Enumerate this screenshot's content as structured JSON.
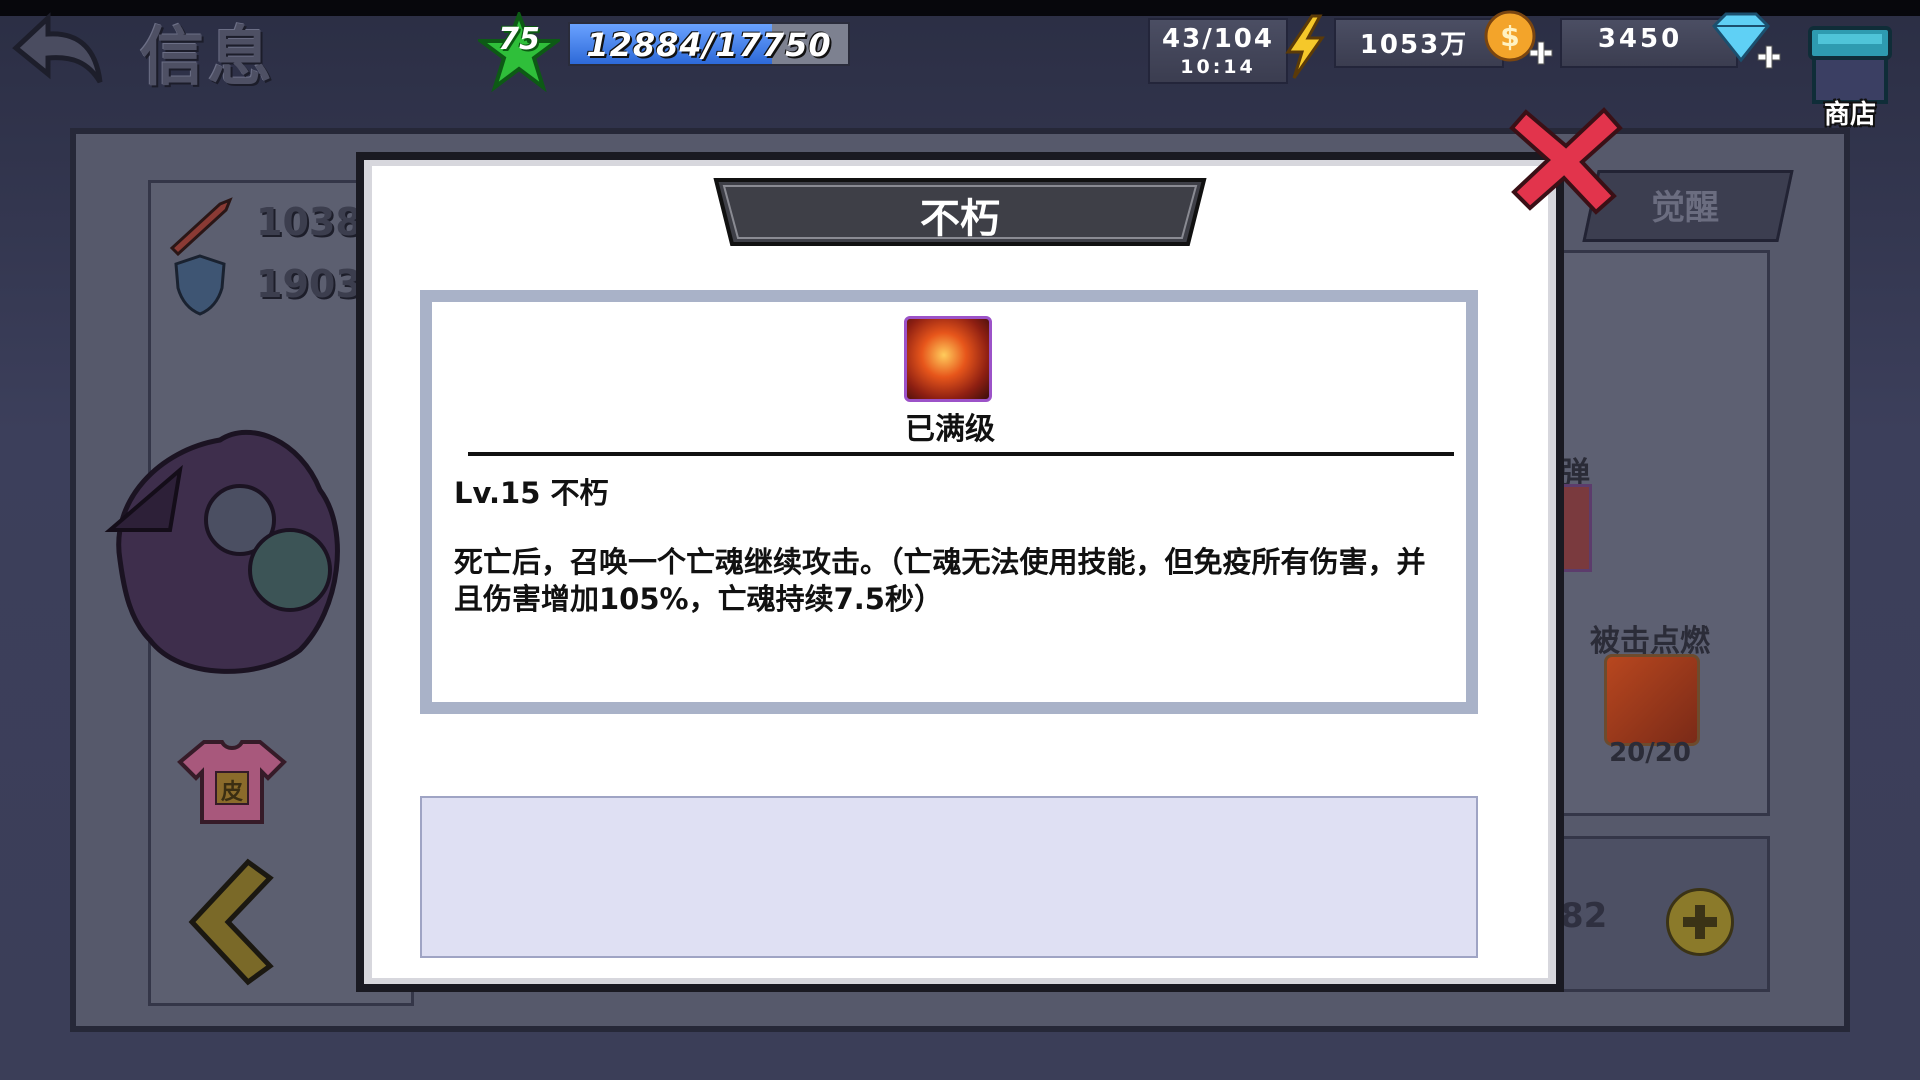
{
  "header": {
    "page_title": "信息",
    "player_level": "75",
    "exp_text": "12884/17750",
    "exp_progress": 0.726,
    "energy_value": "43/104",
    "energy_timer": "10:14",
    "gold_value": "1053万",
    "gem_value": "3450",
    "shop_label": "商店"
  },
  "background": {
    "attack_stat": "1038",
    "defense_stat": "1903",
    "awaken_tab": "觉醒",
    "bullet_label": "弹",
    "ignite_skill_label": "被击点燃",
    "ignite_skill_count": "20/20",
    "count_value": "82",
    "skin_label": "皮"
  },
  "modal": {
    "title": "不朽",
    "max_level_label": "已满级",
    "skill_name_line": "Lv.15 不朽",
    "skill_description": "死亡后，召唤一个亡魂继续攻击。（亡魂无法使用技能，但免疫所有伤害，并且伤害增加105%，亡魂持续7.5秒）"
  },
  "colors": {
    "exp_fill": "#2d69d8",
    "level_star": "#2fbf3a",
    "close_x": "#e2344c",
    "title_banner": "#3e3f47",
    "skill_icon_border": "#9c52c8"
  },
  "icons": {
    "back": "back-arrow-icon",
    "level": "star-icon",
    "energy": "lightning-icon",
    "gold": "coin-icon",
    "gem": "diamond-icon",
    "shop": "shop-icon",
    "close": "close-icon",
    "skill": "fire-fist-icon"
  }
}
